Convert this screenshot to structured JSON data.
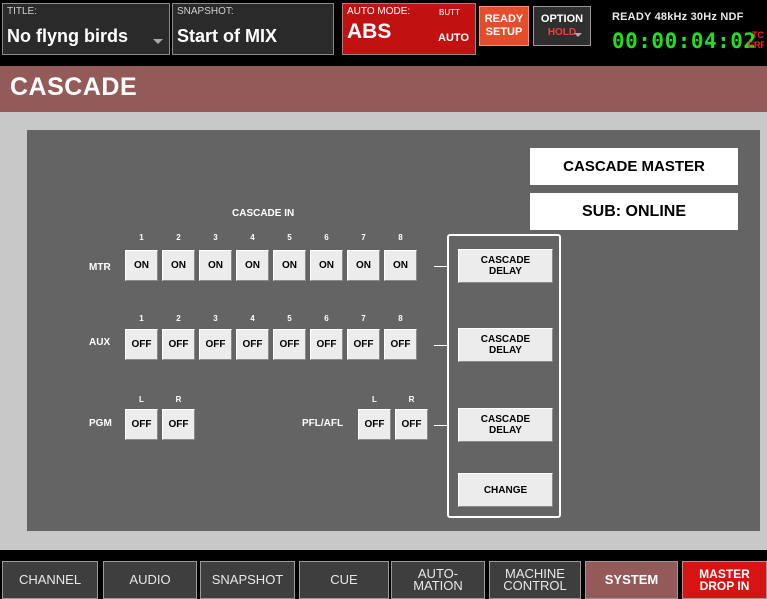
{
  "top": {
    "title_caption": "TITLE:",
    "title_value": "No flyng birds",
    "snapshot_caption": "SNAPSHOT:",
    "snapshot_value": "Start of MIX",
    "auto_mode_caption": "AUTO MODE:",
    "auto_mode_butt": "BUTT",
    "auto_mode_value": "ABS",
    "auto_mode_auto": "AUTO",
    "ready_line1": "READY",
    "ready_line2": "SETUP",
    "option_line1": "OPTION",
    "option_line2": "HOLD",
    "status_line": "READY  48kHz  30Hz NDF",
    "timecode": "00:00:04:02",
    "tc_line1": "TC",
    "tc_line2": "ERR"
  },
  "page": {
    "title": "CASCADE"
  },
  "panel": {
    "master_label": "CASCADE MASTER",
    "sub_label": "SUB: ONLINE",
    "cascade_in_label": "CASCADE IN",
    "mtr": {
      "label": "MTR",
      "channels": [
        "1",
        "2",
        "3",
        "4",
        "5",
        "6",
        "7",
        "8"
      ],
      "states": [
        "ON",
        "ON",
        "ON",
        "ON",
        "ON",
        "ON",
        "ON",
        "ON"
      ]
    },
    "aux": {
      "label": "AUX",
      "channels": [
        "1",
        "2",
        "3",
        "4",
        "5",
        "6",
        "7",
        "8"
      ],
      "states": [
        "OFF",
        "OFF",
        "OFF",
        "OFF",
        "OFF",
        "OFF",
        "OFF",
        "OFF"
      ]
    },
    "pgm": {
      "label": "PGM",
      "channels": [
        "L",
        "R"
      ],
      "states": [
        "OFF",
        "OFF"
      ]
    },
    "pfl": {
      "label": "PFL/AFL",
      "channels": [
        "L",
        "R"
      ],
      "states": [
        "OFF",
        "OFF"
      ]
    },
    "delay_buttons": [
      {
        "line1": "CASCADE",
        "line2": "DELAY"
      },
      {
        "line1": "CASCADE",
        "line2": "DELAY"
      },
      {
        "line1": "CASCADE",
        "line2": "DELAY"
      }
    ],
    "change_label": "CHANGE"
  },
  "nav": {
    "items": [
      {
        "line1": "CHANNEL",
        "line2": ""
      },
      {
        "line1": "AUDIO",
        "line2": ""
      },
      {
        "line1": "SNAPSHOT",
        "line2": ""
      },
      {
        "line1": "CUE",
        "line2": ""
      },
      {
        "line1": "AUTO-",
        "line2": "MATION"
      },
      {
        "line1": "MACHINE",
        "line2": "CONTROL"
      },
      {
        "line1": "SYSTEM",
        "line2": ""
      },
      {
        "line1": "MASTER",
        "line2": "DROP IN"
      }
    ]
  },
  "colors": {
    "header_bg": "#945959",
    "auto_mode_bg": "#c21111",
    "ready_bg": "#e24d2b",
    "timecode": "#22dd22",
    "master_drop_in_bg": "#d61414"
  }
}
